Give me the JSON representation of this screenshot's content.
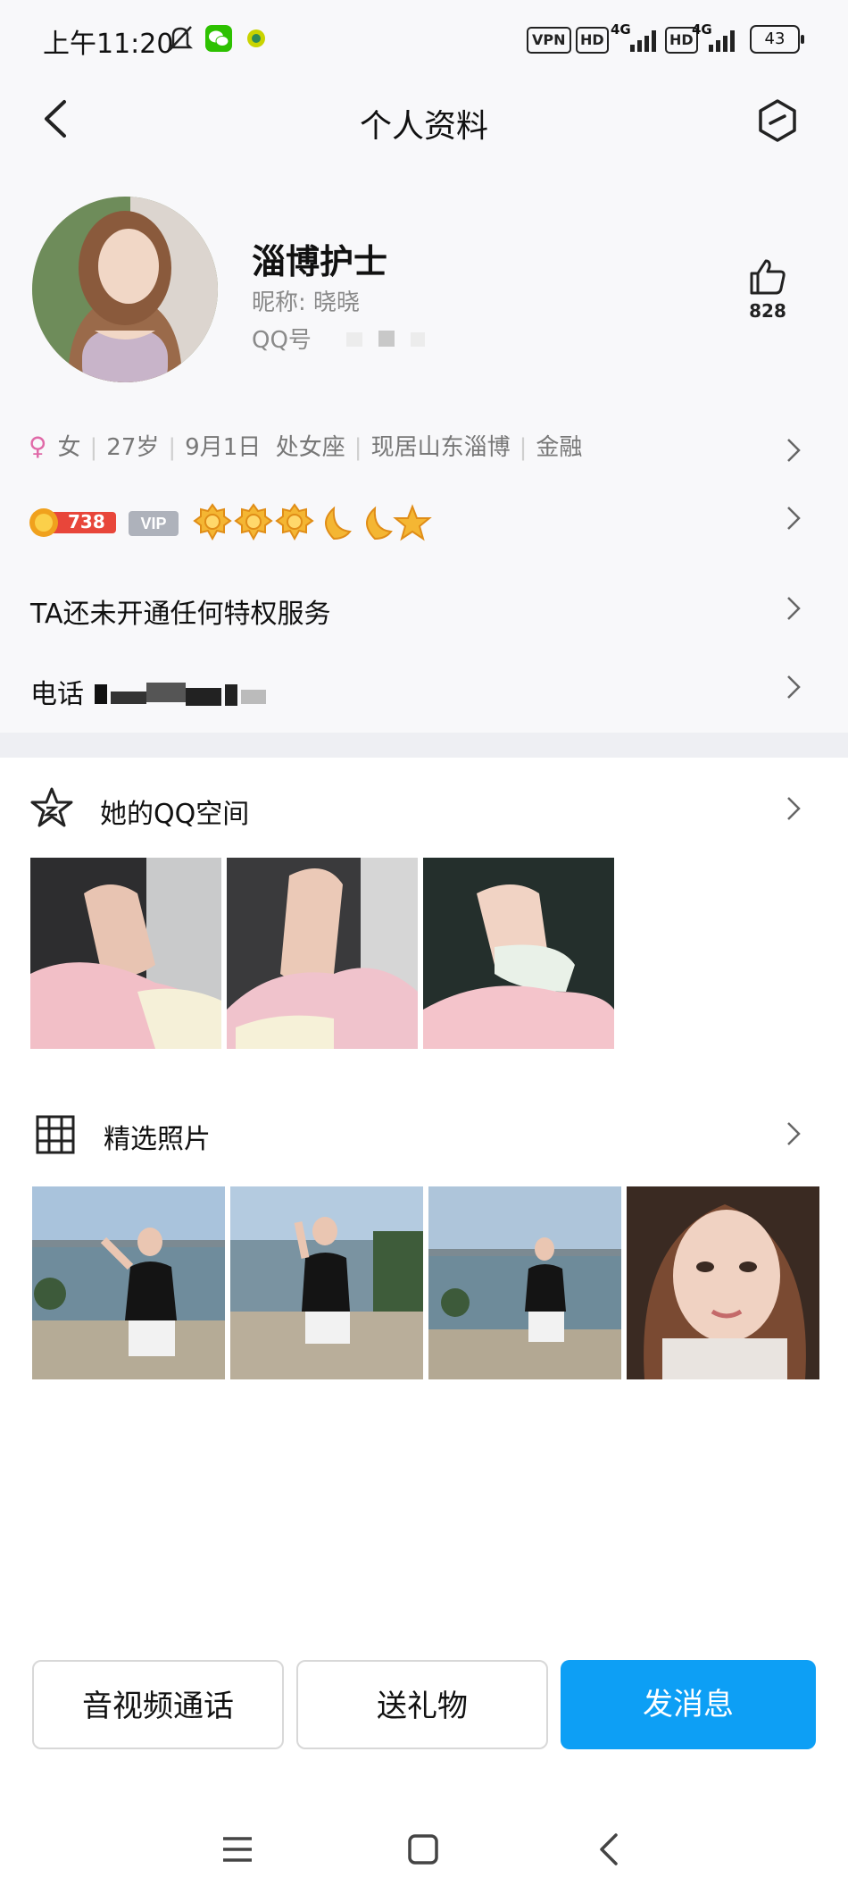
{
  "status_bar": {
    "time": "上午11:20",
    "vpn": "VPN",
    "hd1": "HD",
    "net1": "4G",
    "hd2": "HD",
    "net2": "4G",
    "battery": "43"
  },
  "header": {
    "title": "个人资料"
  },
  "profile": {
    "name": "淄博护士",
    "nickname": "昵称: 晓晓",
    "qq_label": "QQ号",
    "likes": "828",
    "gender_symbol": "♀",
    "info": [
      "女",
      "27岁",
      "9月1日",
      "处女座",
      "现居山东淄博",
      "金融"
    ],
    "points": "738",
    "vip": "VIP"
  },
  "rows": {
    "privilege": "TA还未开通任何特权服务",
    "phone_label": "电话"
  },
  "qzone": {
    "title": "她的QQ空间"
  },
  "photos": {
    "title": "精选照片"
  },
  "actions": {
    "call": "音视频通话",
    "gift": "送礼物",
    "message": "发消息"
  },
  "colors": {
    "accent": "#0d9ff5",
    "female": "#e06aa8",
    "background": "#f8f8fa"
  }
}
